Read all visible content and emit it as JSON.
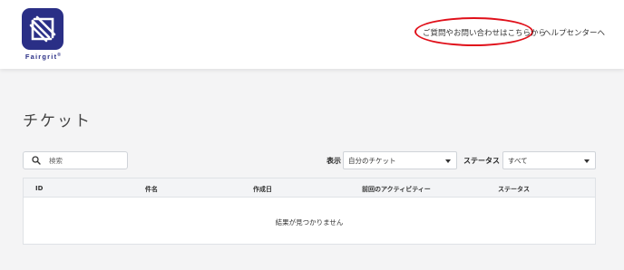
{
  "brand": {
    "name": "Fairgrit",
    "registered": "®",
    "color": "#2a2f86"
  },
  "header": {
    "contact_link": "ご質問やお問い合わせはこちらから",
    "help_link": "ヘルプセンターへ",
    "highlight_color": "#e0101a"
  },
  "page": {
    "title": "チケット"
  },
  "search": {
    "placeholder": "検索",
    "icon": "search-icon"
  },
  "filters": {
    "view_label": "表示",
    "view_selected": "自分のチケット",
    "status_label": "ステータス",
    "status_selected": "すべて"
  },
  "table": {
    "columns": [
      "ID",
      "件名",
      "作成日",
      "前回のアクティビティー",
      "ステータス"
    ],
    "rows": [],
    "empty_message": "結果が見つかりません"
  }
}
